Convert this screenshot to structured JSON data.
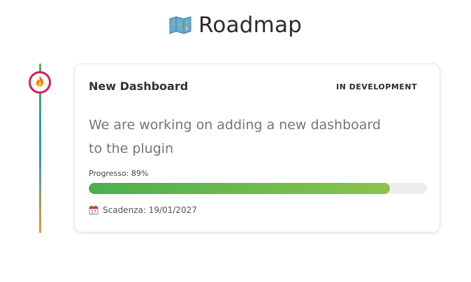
{
  "header": {
    "icon": "map-icon",
    "title": "Roadmap"
  },
  "timeline": {
    "node_icon": "fire-icon",
    "node_color": "#d81b60",
    "line_colors": [
      "#4caf50",
      "#2196c8",
      "#e6a21e"
    ]
  },
  "item": {
    "title": "New Dashboard",
    "status": "IN DEVELOPMENT",
    "description": "We are working on adding a new dashboard to the plugin",
    "progress_label": "Progresso: 89%",
    "progress_value": 0.89,
    "progress_colors": [
      "#4caf50",
      "#8bc34a"
    ],
    "due_icon": "calendar-icon",
    "due_label": "Scadenza: 19/01/2027"
  }
}
